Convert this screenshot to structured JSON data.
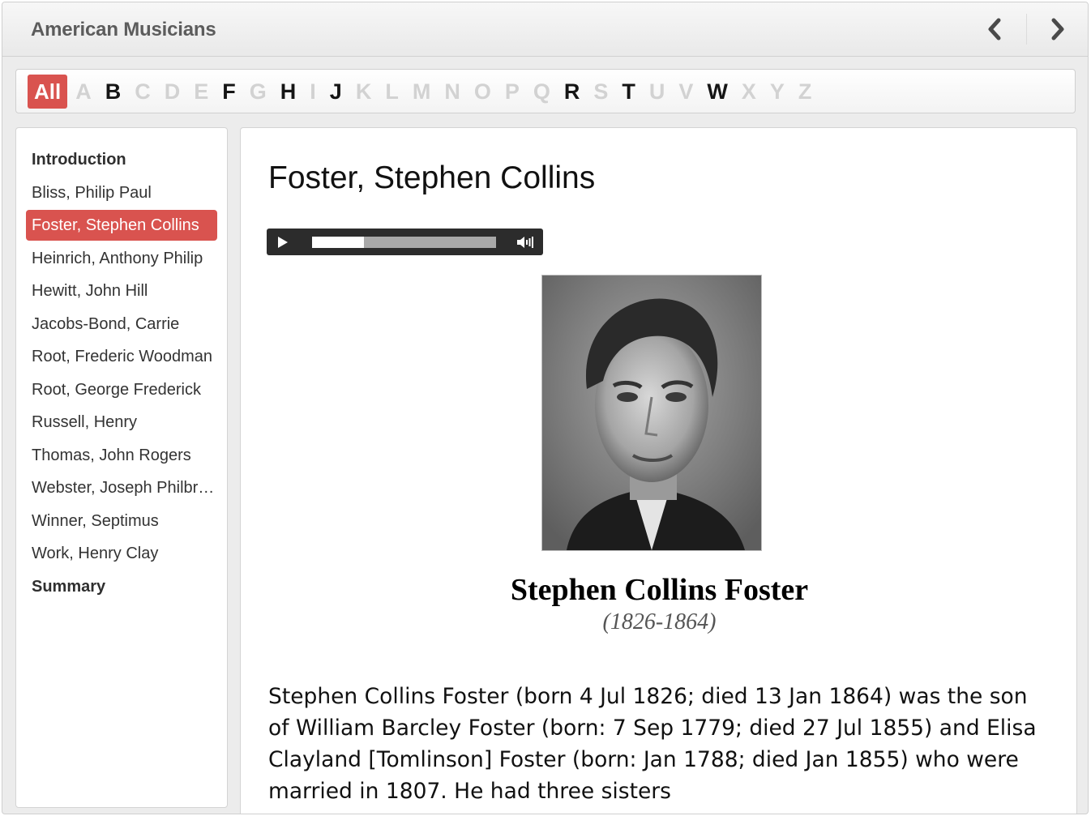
{
  "app": {
    "title": "American Musicians"
  },
  "alphabet": [
    {
      "label": "All",
      "state": "active"
    },
    {
      "label": "A",
      "state": "disabled"
    },
    {
      "label": "B",
      "state": "enabled"
    },
    {
      "label": "C",
      "state": "disabled"
    },
    {
      "label": "D",
      "state": "disabled"
    },
    {
      "label": "E",
      "state": "disabled"
    },
    {
      "label": "F",
      "state": "enabled"
    },
    {
      "label": "G",
      "state": "disabled"
    },
    {
      "label": "H",
      "state": "enabled"
    },
    {
      "label": "I",
      "state": "disabled"
    },
    {
      "label": "J",
      "state": "enabled"
    },
    {
      "label": "K",
      "state": "disabled"
    },
    {
      "label": "L",
      "state": "disabled"
    },
    {
      "label": "M",
      "state": "disabled"
    },
    {
      "label": "N",
      "state": "disabled"
    },
    {
      "label": "O",
      "state": "disabled"
    },
    {
      "label": "P",
      "state": "disabled"
    },
    {
      "label": "Q",
      "state": "disabled"
    },
    {
      "label": "R",
      "state": "enabled"
    },
    {
      "label": "S",
      "state": "disabled"
    },
    {
      "label": "T",
      "state": "enabled"
    },
    {
      "label": "U",
      "state": "disabled"
    },
    {
      "label": "V",
      "state": "disabled"
    },
    {
      "label": "W",
      "state": "enabled"
    },
    {
      "label": "X",
      "state": "disabled"
    },
    {
      "label": "Y",
      "state": "disabled"
    },
    {
      "label": "Z",
      "state": "disabled"
    }
  ],
  "sidebar": {
    "items": [
      {
        "label": "Introduction",
        "kind": "heading"
      },
      {
        "label": "Bliss, Philip Paul",
        "kind": "entry"
      },
      {
        "label": "Foster, Stephen Collins",
        "kind": "entry",
        "selected": true
      },
      {
        "label": "Heinrich, Anthony Philip",
        "kind": "entry"
      },
      {
        "label": "Hewitt, John Hill",
        "kind": "entry"
      },
      {
        "label": "Jacobs-Bond, Carrie",
        "kind": "entry"
      },
      {
        "label": "Root, Frederic Woodman",
        "kind": "entry"
      },
      {
        "label": "Root, George Frederick",
        "kind": "entry"
      },
      {
        "label": "Russell, Henry",
        "kind": "entry"
      },
      {
        "label": "Thomas, John Rogers",
        "kind": "entry"
      },
      {
        "label": "Webster, Joseph Philbrick",
        "kind": "entry"
      },
      {
        "label": "Winner, Septimus",
        "kind": "entry"
      },
      {
        "label": "Work, Henry Clay",
        "kind": "entry"
      },
      {
        "label": "Summary",
        "kind": "heading"
      }
    ]
  },
  "content": {
    "title": "Foster, Stephen Collins",
    "audio": {
      "progress": 0.28
    },
    "portrait_name": "Stephen Collins Foster",
    "portrait_dates": "(1826-1864)",
    "body": "Stephen Collins Foster (born 4 Jul 1826; died 13 Jan 1864) was the son of William Barcley Foster (born: 7 Sep 1779; died 27 Jul 1855) and Elisa Clayland [Tomlinson] Foster (born: Jan 1788; died Jan 1855) who were married in 1807. He had three sisters"
  },
  "colors": {
    "accent": "#d9534f",
    "player": "#2c2c2c"
  },
  "icons": {
    "prev": "chevron-left-icon",
    "next": "chevron-right-icon",
    "play": "play-icon",
    "volume": "volume-icon"
  }
}
